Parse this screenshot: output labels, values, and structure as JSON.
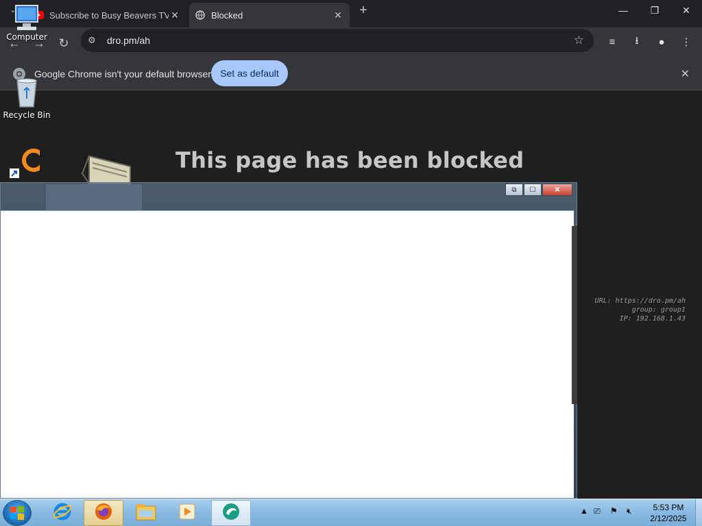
{
  "browser": {
    "tabs": [
      {
        "title": "Subscribe to Busy Beavers TV fo",
        "favicon": "youtube-icon"
      },
      {
        "title": "Blocked",
        "favicon": "globe-icon",
        "active": true
      }
    ],
    "url": "dro.pm/ah",
    "infobar": {
      "message": "Google Chrome isn't your default browser",
      "button": "Set as default"
    }
  },
  "page": {
    "heading": "This page has been blocked",
    "meta": {
      "url_line": "URL: https://dro.pm/ah",
      "group_line": "group: group1",
      "ip_line": "IP: 192.168.1.43"
    }
  },
  "desktop": {
    "icons": [
      {
        "label": "Computer"
      },
      {
        "label": "Recycle Bin"
      }
    ]
  },
  "taskbar": {
    "apps": [
      "internet-explorer-icon",
      "firefox-icon",
      "file-explorer-icon",
      "media-player-icon",
      "app-icon"
    ],
    "clock": {
      "time": "5:53 PM",
      "date": "2/12/2025"
    }
  },
  "colors": {
    "accent": "#a8c7fa",
    "page_bg": "#1f1f1f",
    "taskbar": "#88b9e2"
  }
}
